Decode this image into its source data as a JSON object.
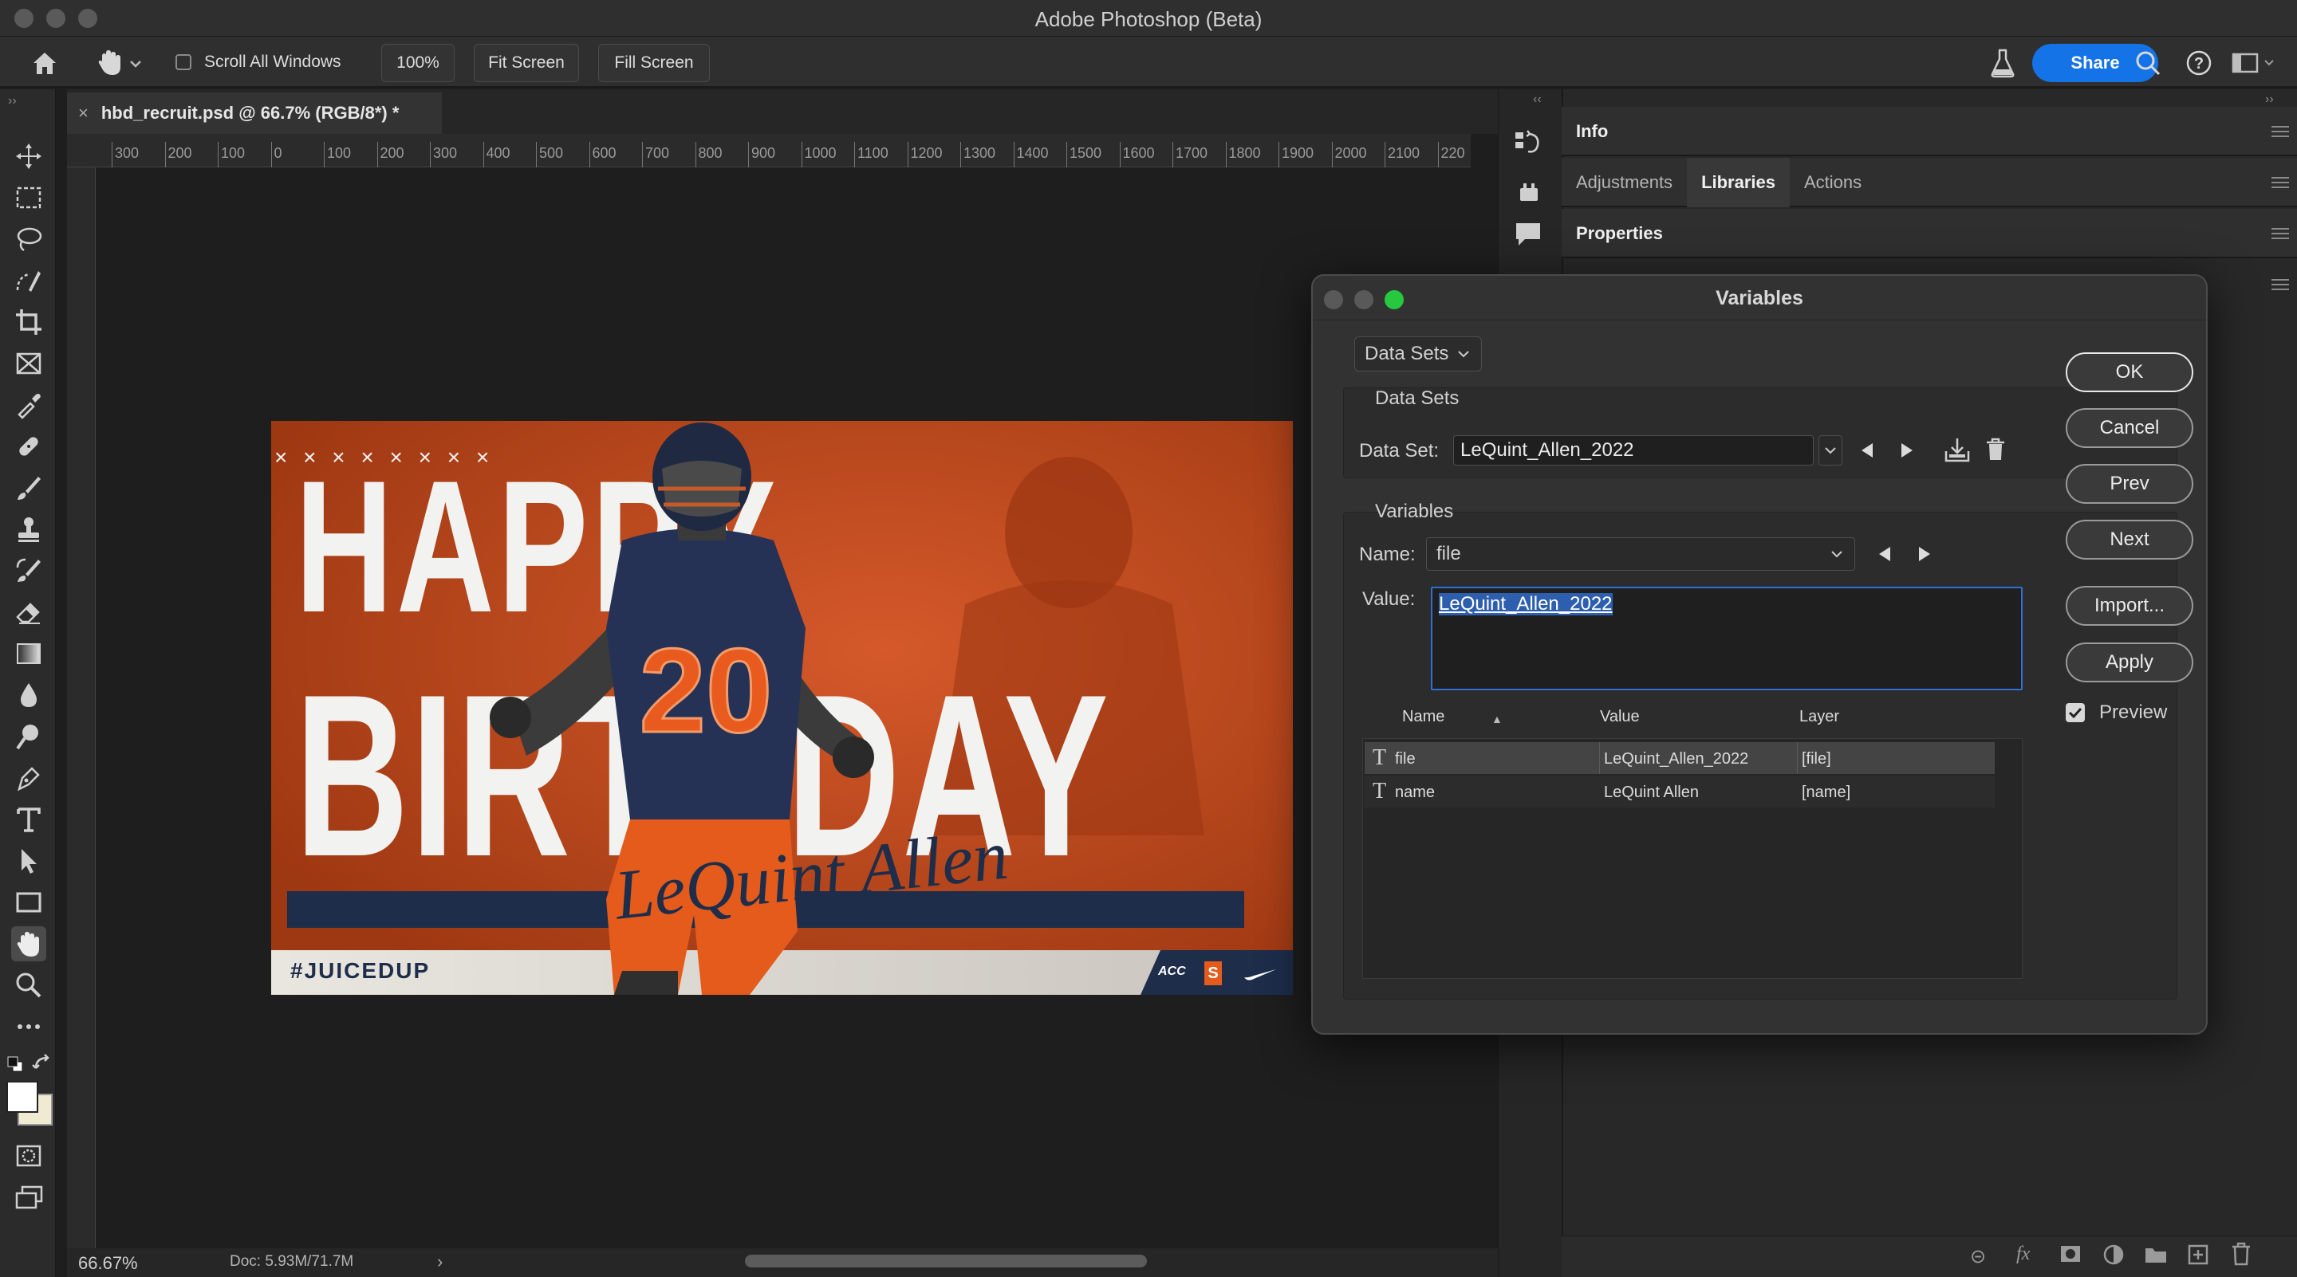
{
  "app": {
    "title": "Adobe Photoshop (Beta)"
  },
  "options_bar": {
    "scroll_all_windows": "Scroll All Windows",
    "zoom": "100%",
    "fit_screen": "Fit Screen",
    "fill_screen": "Fill Screen",
    "share": "Share"
  },
  "document": {
    "tab_title": "hbd_recruit.psd @ 66.7% (RGB/8*) *",
    "zoom_status": "66.67%",
    "doc_info": "Doc: 5.93M/71.7M"
  },
  "ruler": {
    "top_ticks": [
      "300",
      "200",
      "100",
      "0",
      "100",
      "200",
      "300",
      "400",
      "500",
      "600",
      "700",
      "800",
      "900",
      "1000",
      "1100",
      "1200",
      "1300",
      "1400",
      "1500",
      "1600",
      "1700",
      "1800",
      "1900",
      "2000",
      "2100",
      "220"
    ]
  },
  "artwork": {
    "headline_1": "HAPPY",
    "headline_2": "BIRTHDAY",
    "player_name": "LeQuint Allen",
    "jersey_number": "20",
    "hashtag": "#JUICEDUP",
    "conference": "ACC",
    "school_mark": "S",
    "crosses": "× × × × × × × ×",
    "colors": {
      "orange": "#c2491e",
      "navy": "#1d2d4a",
      "white": "#f2f2f0"
    }
  },
  "right_panels": {
    "info": "Info",
    "adjustments": "Adjustments",
    "libraries": "Libraries",
    "actions": "Actions",
    "properties": "Properties"
  },
  "dialog": {
    "title": "Variables",
    "mode_select": "Data Sets",
    "datasets_group": "Data Sets",
    "dataset_label": "Data Set:",
    "dataset_value": "LeQuint_Allen_2022",
    "variables_group": "Variables",
    "name_label": "Name:",
    "name_value": "file",
    "value_label": "Value:",
    "value_text": "LeQuint_Allen_2022",
    "table": {
      "headers": {
        "name": "Name",
        "value": "Value",
        "layer": "Layer"
      },
      "rows": [
        {
          "name": "file",
          "value": "LeQuint_Allen_2022",
          "layer": "[file]"
        },
        {
          "name": "name",
          "value": "LeQuint Allen",
          "layer": "[name]"
        }
      ]
    },
    "buttons": {
      "ok": "OK",
      "cancel": "Cancel",
      "prev": "Prev",
      "next": "Next",
      "import": "Import...",
      "apply": "Apply"
    },
    "preview_label": "Preview",
    "preview_checked": true
  }
}
